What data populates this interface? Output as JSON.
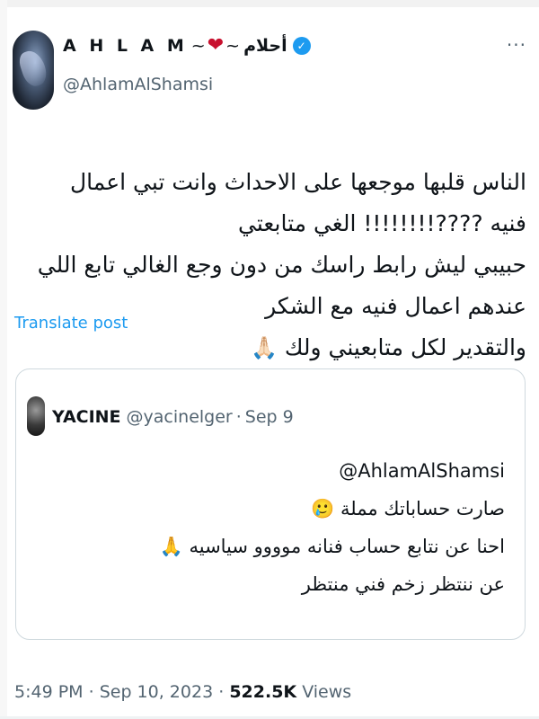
{
  "tweet": {
    "author": {
      "display_name": "A H L A M",
      "tilde_left": "~",
      "heart": "❤",
      "tilde_right": "~",
      "arabic_name": "أحلام",
      "verified_icon": "✓",
      "handle": "@AhlamAlShamsi"
    },
    "more_icon": "···",
    "text_lines": [
      "الناس قلبها موجعها على الاحداث وانت تبي اعمال فنيه ????!!!!!!!! الغي متابعتي",
      "حبيبي ليش رابط راسك من دون وجع الغالي تابع اللي عندهم اعمال فنيه مع الشكر",
      "والتقدير لكل متابعيني ولك"
    ],
    "pray_emoji": "🙏🏻",
    "translate_label": "Translate post",
    "quote": {
      "name": "YACINE",
      "handle": "@yacinelger",
      "separator": "·",
      "date": "Sep 9",
      "mention": "@AhlamAlShamsi",
      "line1": "صارت حساباتك مملة",
      "line1_emoji": "🥲",
      "line2": "احنا عن نتابع حساب فنانه موووو سياسيه",
      "line2_emoji": "🙏",
      "line3": "عن ننتظر زخم فني منتظر"
    },
    "meta": {
      "time": "5:49 PM",
      "sep": "·",
      "date": "Sep 10, 2023",
      "views_count": "522.5K",
      "views_label": "Views"
    }
  },
  "colors": {
    "text": "#0f1419",
    "secondary": "#536471",
    "link": "#1d9bf0",
    "border": "#cfd9de",
    "heart": "#c8102e"
  }
}
